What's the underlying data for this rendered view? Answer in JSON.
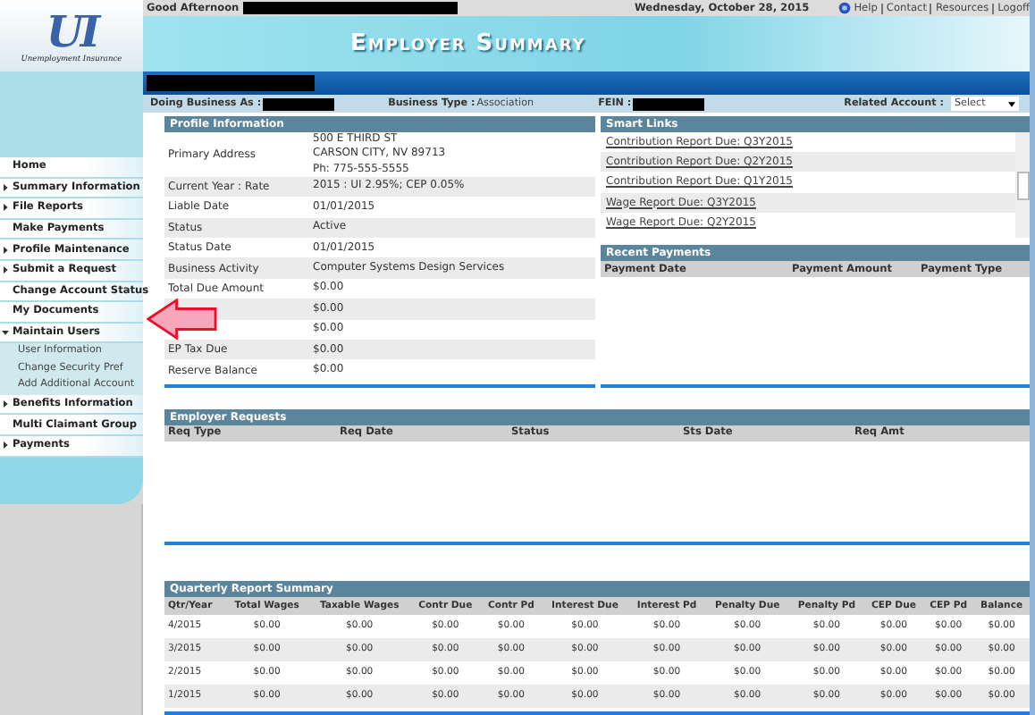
{
  "logo": {
    "letters": "UI",
    "tagline": "Unemployment Insurance"
  },
  "top_bar": {
    "greeting": "Good Afternoon",
    "date": "Wednesday, October 28, 2015",
    "links": [
      "Help",
      "Contact",
      "Resources",
      "Logoff"
    ]
  },
  "banner": {
    "title": "Employer Summary"
  },
  "info_bar": {
    "doing_business_label": "Doing Business As :",
    "business_type_label": "Business Type :",
    "business_type": "Association",
    "fein_label": "FEIN :",
    "related_account_label": "Related Account :",
    "related_account_value": "Select"
  },
  "sidebar": {
    "items": [
      {
        "kind": "link",
        "label": "Home"
      },
      {
        "kind": "group",
        "label": "Summary Information",
        "expanded": false
      },
      {
        "kind": "group",
        "label": "File Reports",
        "expanded": false
      },
      {
        "kind": "link",
        "label": "Make Payments"
      },
      {
        "kind": "group",
        "label": "Profile Maintenance",
        "expanded": false
      },
      {
        "kind": "group",
        "label": "Submit a Request",
        "expanded": false
      },
      {
        "kind": "link",
        "label": "Change Account Status"
      },
      {
        "kind": "link",
        "label": "My Documents"
      },
      {
        "kind": "group",
        "label": "Maintain Users",
        "expanded": true,
        "children": [
          {
            "label": "User Information"
          },
          {
            "label": "Change Security Pref"
          },
          {
            "label": "Add Additional Account"
          }
        ]
      },
      {
        "kind": "group",
        "label": "Benefits Information",
        "expanded": false
      },
      {
        "kind": "link",
        "label": "Multi Claimant Group"
      },
      {
        "kind": "group",
        "label": "Payments",
        "expanded": false
      }
    ]
  },
  "profile": {
    "title": "Profile Information",
    "rows": [
      {
        "label": "Primary Address",
        "lines": [
          "500 E THIRD ST",
          "CARSON CITY, NV 89713",
          "Ph:  775-555-5555"
        ]
      },
      {
        "label": "Current Year : Rate",
        "lines": [
          "2015 : UI 2.95%; CEP 0.05%"
        ]
      },
      {
        "label": "Liable Date",
        "lines": [
          "01/01/2015"
        ]
      },
      {
        "label": "Status",
        "lines": [
          "Active"
        ]
      },
      {
        "label": "Status Date",
        "lines": [
          "01/01/2015"
        ]
      },
      {
        "label": "Business Activity",
        "lines": [
          "Computer Systems Design Services"
        ]
      },
      {
        "label": "Total Due Amount",
        "lines": [
          "$0.00"
        ]
      },
      {
        "lines": [
          "$0.00"
        ]
      },
      {
        "lines": [
          "$0.00"
        ]
      },
      {
        "label": "EP Tax Due",
        "lines": [
          "$0.00"
        ]
      },
      {
        "label": "Reserve Balance",
        "lines": [
          "$0.00"
        ]
      }
    ]
  },
  "smart_links": {
    "title": "Smart Links",
    "items": [
      "Contribution Report Due: Q3Y2015",
      "Contribution Report Due: Q2Y2015",
      "Contribution Report Due: Q1Y2015",
      "Wage Report Due: Q3Y2015",
      "Wage Report Due: Q2Y2015"
    ]
  },
  "recent_payments": {
    "title": "Recent Payments",
    "columns": [
      "Payment Date",
      "Payment Amount",
      "Payment Type"
    ]
  },
  "employer_requests": {
    "title": "Employer Requests",
    "columns": [
      "Req Type",
      "Req Date",
      "Status",
      "Sts Date",
      "Req Amt"
    ]
  },
  "quarterly": {
    "title": "Quarterly Report Summary",
    "columns": [
      "Qtr/Year",
      "Total Wages",
      "Taxable Wages",
      "Contr Due",
      "Contr Pd",
      "Interest Due",
      "Interest Pd",
      "Penalty Due",
      "Penalty Pd",
      "CEP Due",
      "CEP Pd",
      "Balance"
    ],
    "rows": [
      [
        "4/2015",
        "$0.00",
        "$0.00",
        "$0.00",
        "$0.00",
        "$0.00",
        "$0.00",
        "$0.00",
        "$0.00",
        "$0.00",
        "$0.00",
        "$0.00"
      ],
      [
        "3/2015",
        "$0.00",
        "$0.00",
        "$0.00",
        "$0.00",
        "$0.00",
        "$0.00",
        "$0.00",
        "$0.00",
        "$0.00",
        "$0.00",
        "$0.00"
      ],
      [
        "2/2015",
        "$0.00",
        "$0.00",
        "$0.00",
        "$0.00",
        "$0.00",
        "$0.00",
        "$0.00",
        "$0.00",
        "$0.00",
        "$0.00",
        "$0.00"
      ],
      [
        "1/2015",
        "$0.00",
        "$0.00",
        "$0.00",
        "$0.00",
        "$0.00",
        "$0.00",
        "$0.00",
        "$0.00",
        "$0.00",
        "$0.00",
        "$0.00"
      ]
    ]
  }
}
